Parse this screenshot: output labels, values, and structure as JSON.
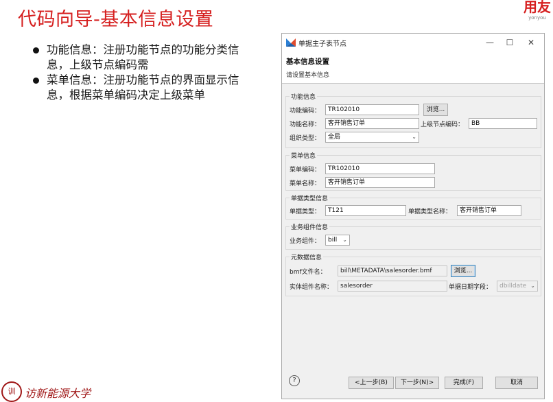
{
  "slide": {
    "title": "代码向导-基本信息设置",
    "logo_mark": "用友",
    "logo_sub": "yonyou",
    "bullets": [
      "功能信息：注册功能节点的功能分类信息，上级节点编码需",
      "菜单信息：注册功能节点的界面显示信息，根据菜单编码决定上级菜单"
    ],
    "seal_char": "训",
    "bottom_script": "访新能源大学"
  },
  "dialog": {
    "title": "单据主子表节点",
    "header_title": "基本信息设置",
    "header_subtitle": "请设置基本信息",
    "function_group": {
      "label": "功能信息",
      "code_label": "功能编码：",
      "code_value": "TR102010",
      "browse_label": "浏览...",
      "name_label": "功能名称：",
      "name_value": "客开销售订单",
      "parent_label": "上级节点编码：",
      "parent_value": "BB",
      "org_label": "组织类型：",
      "org_value": "全局"
    },
    "menu_group": {
      "label": "菜单信息",
      "code_label": "菜单编码：",
      "code_value": "TR102010",
      "name_label": "菜单名称：",
      "name_value": "客开销售订单"
    },
    "billtype_group": {
      "label": "单据类型信息",
      "type_label": "单据类型：",
      "type_value": "T121",
      "typename_label": "单据类型名称：",
      "typename_value": "客开销售订单"
    },
    "component_group": {
      "label": "业务组件信息",
      "comp_label": "业务组件：",
      "comp_value": "bill"
    },
    "metadata_group": {
      "label": "元数据信息",
      "bmf_label": "bmf文件名：",
      "bmf_value": "bill\\METADATA\\salesorder.bmf",
      "browse_label": "浏览...",
      "entity_label": "实体组件名称：",
      "entity_value": "salesorder",
      "date_label": "单据日期字段：",
      "date_value": "dbilldate"
    },
    "buttons": {
      "prev": "<上一步(B)",
      "next": "下一步(N)>",
      "finish": "完成(F)",
      "cancel": "取消"
    },
    "window_controls": {
      "minimize": "—",
      "maximize": "☐",
      "close": "✕"
    }
  },
  "colors": {
    "title_red": "#d62020",
    "accent_blue": "#3c7fb1"
  }
}
